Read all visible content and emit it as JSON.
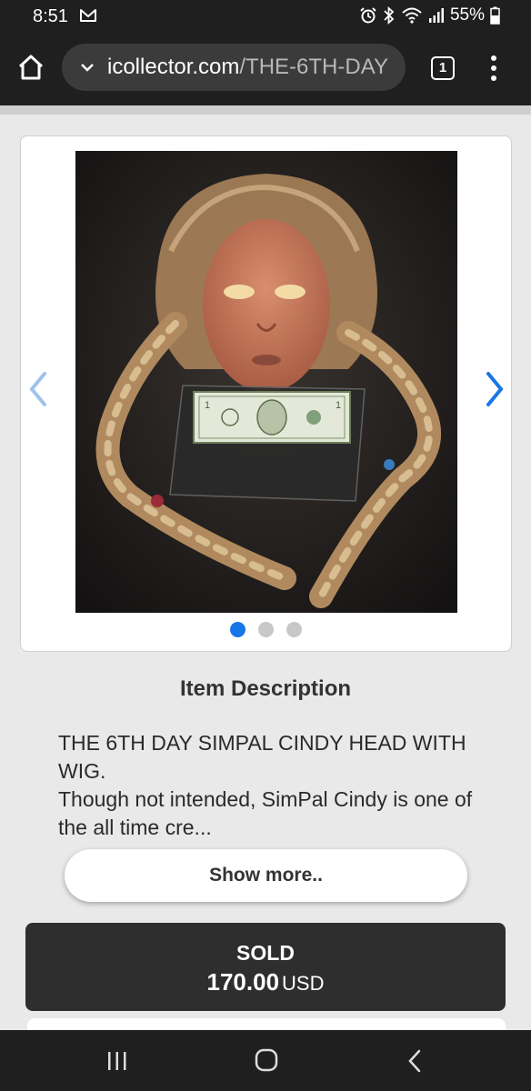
{
  "status_bar": {
    "time": "8:51",
    "battery": "55%"
  },
  "browser": {
    "url_domain": "icollector.com",
    "url_path": "/THE-6TH-DAY",
    "tab_count": "1"
  },
  "gallery": {
    "image_count": 3,
    "active_index": 0,
    "dots": [
      "",
      "",
      ""
    ]
  },
  "description": {
    "heading": "Item Description",
    "line1": "THE 6TH DAY SIMPAL CINDY HEAD WITH WIG.",
    "line2": "Though not intended, SimPal Cindy is one of the all time cre...",
    "show_more_label": "Show more.."
  },
  "sale": {
    "status": "SOLD",
    "amount": "170.00",
    "currency": "USD"
  },
  "colors": {
    "accent": "#1976e8",
    "chrome_dark": "#1f1f1f",
    "sold_bg": "#2e2e2e"
  }
}
